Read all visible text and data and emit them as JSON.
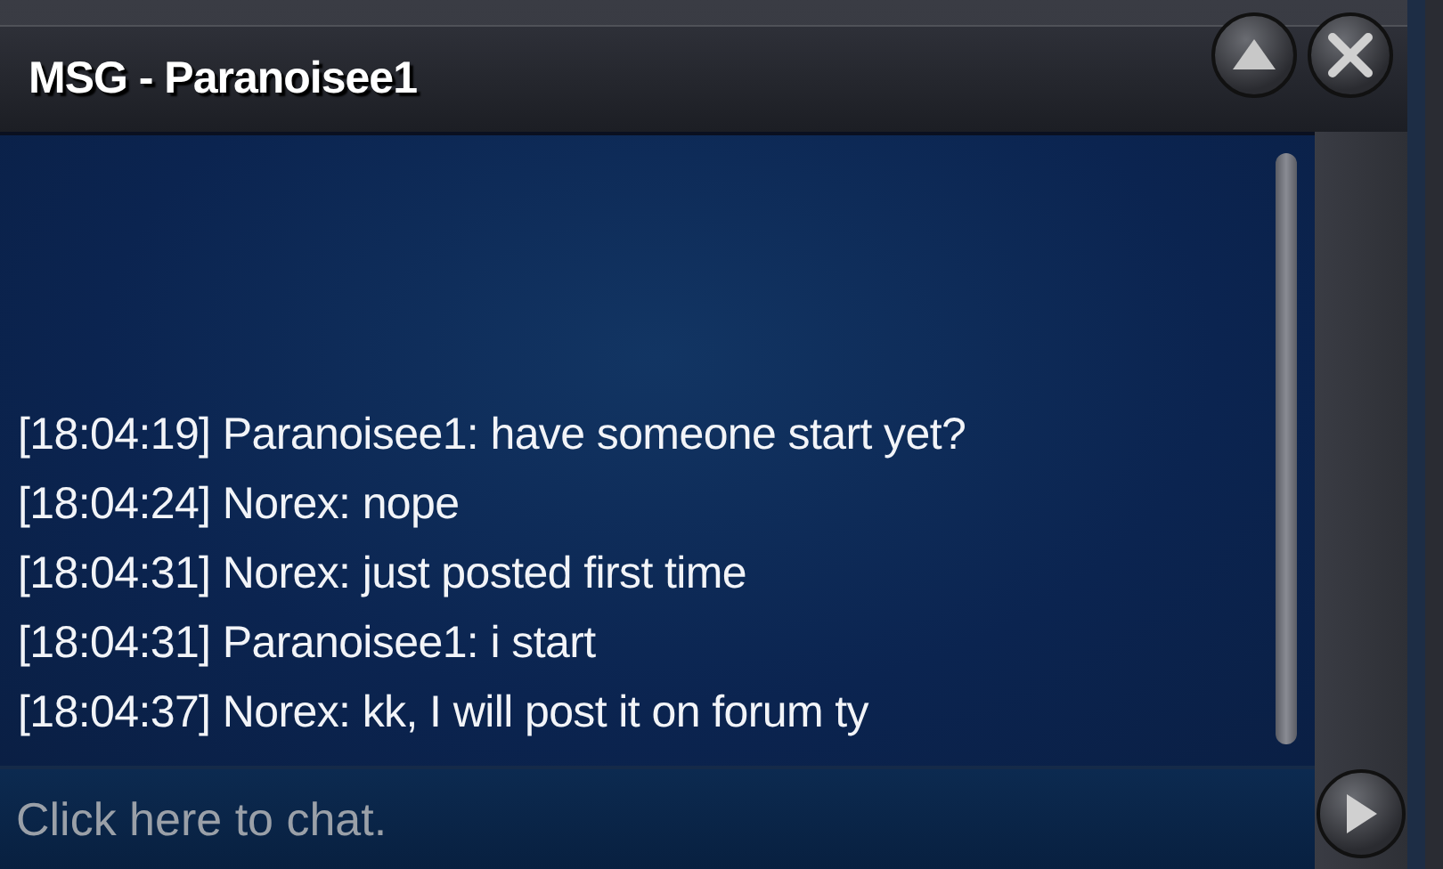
{
  "window": {
    "title": "MSG - Paranoisee1"
  },
  "messages": [
    {
      "time": "[18:04:19]",
      "text": "Paranoisee1: have someone start yet?"
    },
    {
      "time": "[18:04:24]",
      "text": "Norex: nope"
    },
    {
      "time": "[18:04:31]",
      "text": "Norex: just posted first time"
    },
    {
      "time": "[18:04:31]",
      "text": "Paranoisee1: i start"
    },
    {
      "time": "[18:04:37]",
      "text": "Norex: kk, I will post it on forum ty"
    }
  ],
  "input": {
    "placeholder": "Click here to chat."
  }
}
